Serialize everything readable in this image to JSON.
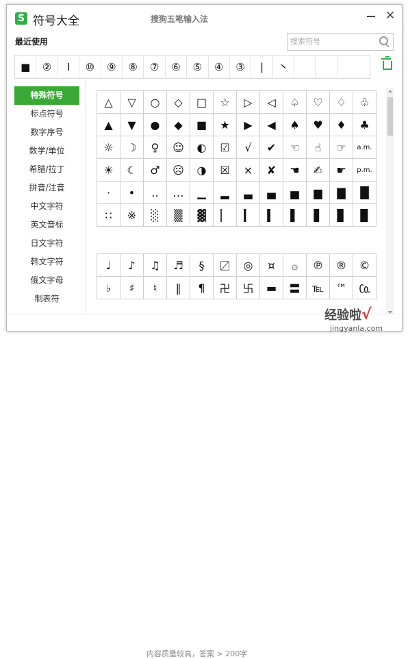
{
  "window": {
    "logo_letter": "S",
    "title": "符号大全",
    "ime_title": "搜狗五笔输入法",
    "close_glyph": "✕"
  },
  "recent": {
    "label": "最近使用",
    "items": [
      "■",
      "②",
      "Ⅰ",
      "⑩",
      "⑨",
      "⑧",
      "⑦",
      "⑥",
      "⑤",
      "④",
      "③",
      "|",
      "丶",
      "",
      "",
      ""
    ]
  },
  "search": {
    "placeholder": "搜索符号"
  },
  "sidebar": {
    "items": [
      "特殊符号",
      "标点符号",
      "数字序号",
      "数学/单位",
      "希腊/拉丁",
      "拼音/注音",
      "中文字符",
      "英文音标",
      "日文字符",
      "韩文字符",
      "俄文字母",
      "制表符"
    ],
    "active": 0
  },
  "special_grid": [
    "△",
    "▽",
    "○",
    "◇",
    "□",
    "☆",
    "▷",
    "◁",
    "♤",
    "♡",
    "♢",
    "♧",
    "▲",
    "▼",
    "●",
    "◆",
    "■",
    "★",
    "▶",
    "◀",
    "♠",
    "♥",
    "♦",
    "♣",
    "☼",
    "☽",
    "♀",
    "☺",
    "◐",
    "☑",
    "√",
    "✔",
    "☜",
    "☝",
    "☞",
    "a.m.",
    "☀",
    "☾",
    "♂",
    "☹",
    "◑",
    "☒",
    "×",
    "✘",
    "☚",
    "✍",
    "☛",
    "p.m.",
    "·",
    "•",
    "‥",
    "…",
    "▁",
    "▂",
    "▃",
    "▄",
    "▅",
    "▆",
    "▇",
    "█",
    "∷",
    "※",
    "░",
    "▒",
    "▓",
    "▏",
    "▎",
    "▍",
    "▌",
    "▋",
    "▊",
    "▉"
  ],
  "music_grid": [
    "♩",
    "♪",
    "♫",
    "♬",
    "§",
    "〼",
    "◎",
    "¤",
    "۞",
    "℗",
    "®",
    "©",
    "♭",
    "♯",
    "♮",
    "‖",
    "¶",
    "卍",
    "卐",
    "▬",
    "〓",
    "℡",
    "™",
    "㏇"
  ],
  "background": {
    "footer_text": "内容质量较高，答案 > 200字",
    "green_glyph": "["
  },
  "watermark": {
    "text": "经验啦",
    "check": "√",
    "url": "jingyanla.com"
  },
  "colors": {
    "accent": "#3aaa35",
    "border": "#cfcfcf"
  }
}
